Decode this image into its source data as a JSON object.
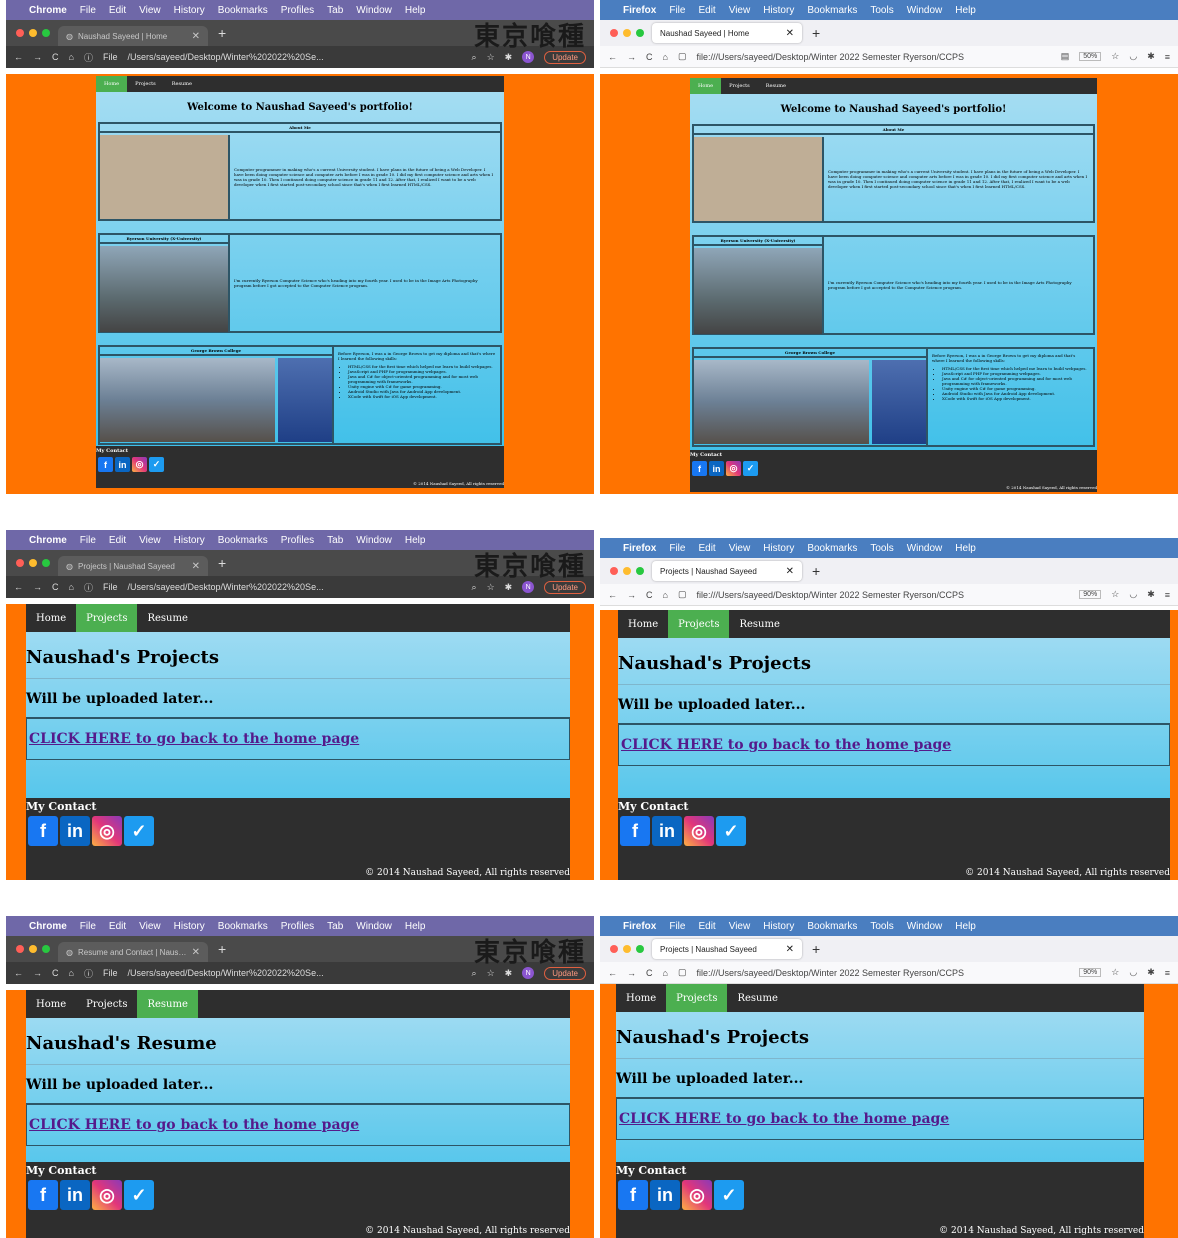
{
  "menus": {
    "chrome": [
      "Chrome",
      "File",
      "Edit",
      "View",
      "History",
      "Bookmarks",
      "Profiles",
      "Tab",
      "Window",
      "Help"
    ],
    "firefox": [
      "Firefox",
      "File",
      "Edit",
      "View",
      "History",
      "Bookmarks",
      "Tools",
      "Window",
      "Help"
    ]
  },
  "colors": {
    "chrome_menubar": "#6f68a8",
    "firefox_menubar": "#4a7ec0",
    "page_background": "#ff7300",
    "nav_active": "#4caf50",
    "nav_background": "#2e2e2e"
  },
  "chrome_url": "/Users/sayeed/Desktop/Winter%202022%20Se...",
  "chrome_file_label": "File",
  "chrome_update": "Update",
  "chrome_avatar": "N",
  "firefox_url": "file:///Users/sayeed/Desktop/Winter 2022 Semester Ryerson/CCPS",
  "overlay_text": "東京喰種",
  "tabs": {
    "p0": "Naushad Sayeed | Home",
    "p1": "Naushad Sayeed | Home",
    "p2": "Projects | Naushad Sayeed",
    "p3": "Projects | Naushad Sayeed",
    "p4": "Resume and Contact | Naushad",
    "p5": "Projects | Naushad Sayeed"
  },
  "zoom": {
    "p1": "50%",
    "p3": "90%",
    "p5": "90%"
  },
  "nav": {
    "home": "Home",
    "projects": "Projects",
    "resume": "Resume"
  },
  "home": {
    "title": "Welcome to Naushad Sayeed's portfolio!",
    "about_header": "About Me",
    "about_text": "Computer programmer in making who's a current University student. I have plans in the future of being a Web Developer. I have been doing computer science and computer arts before I was in grade 10. I did my first computer science and arts when I was in grade 10. Then I continued doing computer science in grade 11 and 12. After that, I realized I want to be a web developer when I first started post-secondary school since that's when I first learned HTML/CSS.",
    "ryerson_header": "Ryerson University (X-University)",
    "ryerson_text": "I'm currently Ryerson Computer Science who's heading into my fourth year. I used to be in the Image Arts Photography program before I got accepted to the Computer Science program.",
    "gb_header": "George Brown College",
    "gb_text": "Before Ryerson, I was a in George Brown to get my diploma and that's where I learned the following skills:",
    "gb_skills": [
      "HTML/CSS for the first time which helped me learn to build webpages.",
      "JavaScript and PHP for programming webpages.",
      "Java and C# for object-oriented programming and for most web programming with frameworks.",
      "Unity engine with C# for game programming.",
      "Android Studio with Java for Android App development.",
      "XCode with Swift for iOS App development."
    ]
  },
  "contact_label": "My Contact",
  "copyright": "© 2014 Naushad Sayeed, All rights reserved",
  "projects_title": "Naushad's Projects",
  "resume_title": "Naushad's Resume",
  "uploaded": "Will be uploaded later...",
  "back_link": "CLICK HERE to go back to the home page",
  "social_icons": [
    "facebook-icon",
    "linkedin-icon",
    "instagram-icon",
    "twitter-icon"
  ]
}
